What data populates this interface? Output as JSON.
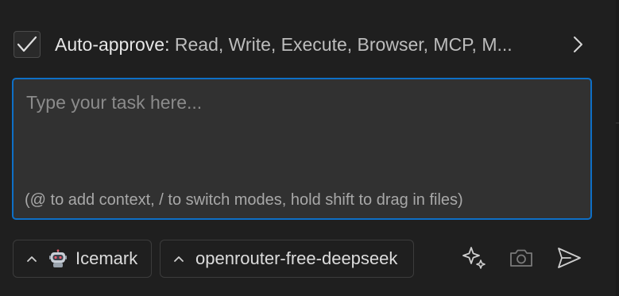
{
  "auto_approve": {
    "checked": true,
    "label": "Auto-approve:",
    "items_text": "Read, Write, Execute, Browser, MCP, M..."
  },
  "task_input": {
    "placeholder": "Type your task here...",
    "value": "",
    "hint": "(@ to add context, / to switch modes, hold shift to drag in files)"
  },
  "mode_selector": {
    "label": "Icemark",
    "icon": "robot-icon"
  },
  "model_selector": {
    "label": "openrouter-free-deepseek"
  },
  "actions": {
    "enhance_icon": "sparkle-icon",
    "screenshot_icon": "camera-icon",
    "send_icon": "send-icon"
  },
  "colors": {
    "background": "#1f1f1f",
    "input_background": "#313131",
    "focus_border": "#0e6fc6",
    "text": "#cccccc"
  }
}
